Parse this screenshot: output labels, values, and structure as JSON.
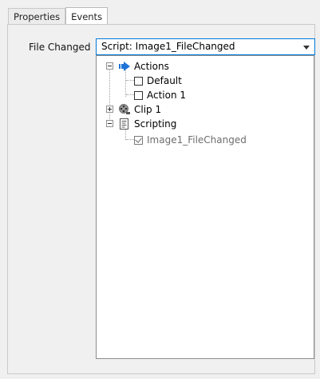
{
  "tabs": [
    {
      "label": "Properties",
      "active": false
    },
    {
      "label": "Events",
      "active": true
    }
  ],
  "field": {
    "label": "File Changed",
    "value": "Script: Image1_FileChanged"
  },
  "tree": {
    "actions": {
      "label": "Actions",
      "icon": "arrow-right-icon",
      "expanded": true
    },
    "default": {
      "label": "Default",
      "checked": false
    },
    "action1": {
      "label": "Action 1",
      "checked": false
    },
    "clip1": {
      "label": "Clip 1",
      "icon": "film-reel-icon",
      "expanded": false
    },
    "scripting": {
      "label": "Scripting",
      "icon": "script-icon",
      "expanded": true
    },
    "image1": {
      "label": "Image1_FileChanged",
      "checked": true
    }
  },
  "colors": {
    "accent": "#0078d7",
    "arrow_blue": "#1e73d8",
    "muted_text": "#6d6d6d"
  }
}
